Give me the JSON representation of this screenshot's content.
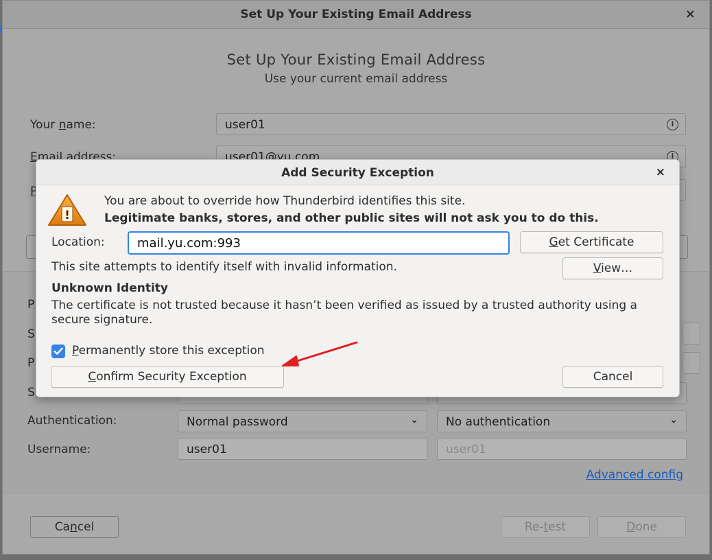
{
  "window": {
    "title": "Set Up Your Existing Email Address",
    "close": "×",
    "heading": "Set Up Your Existing Email Address",
    "subheading": "Use your current email address"
  },
  "form": {
    "name_label_pre": "Your ",
    "name_label_u": "n",
    "name_label_post": "ame:",
    "name_value": "user01",
    "email_label_u": "E",
    "email_label_post": "mail address:",
    "email_value": "user01@yu.com",
    "p_fragment": "P"
  },
  "server": {
    "row_letters": [
      "P",
      "S",
      "P",
      "S"
    ],
    "auth_label": "Authentication:",
    "auth_incoming": "Normal password",
    "auth_outgoing": "No authentication",
    "username_label": "Username:",
    "username_incoming": "user01",
    "username_outgoing": "user01",
    "advanced_link": "Advanced config"
  },
  "footer": {
    "cancel_pre": "Ca",
    "cancel_u": "n",
    "cancel_post": "cel",
    "retest_pre": "Re-",
    "retest_u": "t",
    "retest_post": "est",
    "done_u": "D",
    "done_post": "one"
  },
  "dialog": {
    "title": "Add Security Exception",
    "close": "×",
    "message": "You are about to override how Thunderbird identifies this site.",
    "warning": "Legitimate banks, stores, and other public sites will not ask you to do this.",
    "location_label": "Location:",
    "location_value": "mail.yu.com:993",
    "get_cert_u": "G",
    "get_cert_post": "et Certificate",
    "site_status": "This site attempts to identify itself with invalid information.",
    "view_u": "V",
    "view_post": "iew…",
    "unknown_title": "Unknown Identity",
    "unknown_desc": "The certificate is not trusted because it hasn’t been verified as issued by a trusted authority using a secure signature.",
    "store_u": "P",
    "store_post": "ermanently store this exception",
    "store_checked": true,
    "confirm_u": "C",
    "confirm_post": "onfirm Security Exception",
    "cancel": "Cancel"
  },
  "colors": {
    "accent": "#3584e4",
    "annotation_arrow": "#e02020",
    "link": "#1b5bbd",
    "warning_icon": "#f0911a"
  },
  "icons": [
    "info-icon",
    "warning-icon",
    "chevron-down-icon",
    "check-icon",
    "close-icon"
  ]
}
